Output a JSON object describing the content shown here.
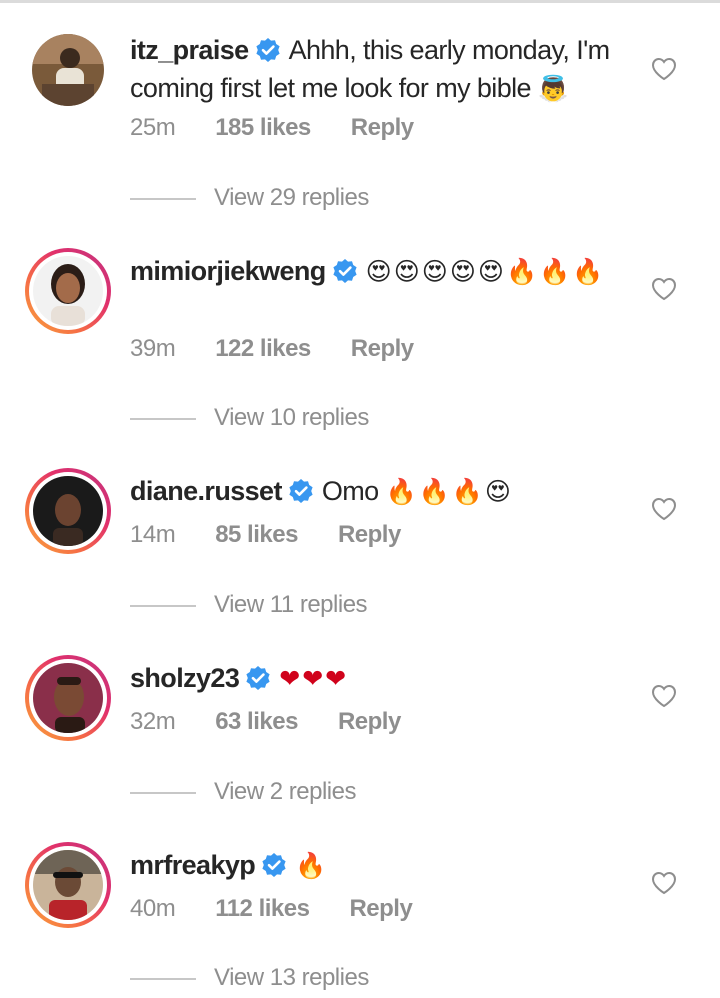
{
  "comments": [
    {
      "username": "itz_praise",
      "text": "Ahhh, this early monday, I'm coming first let me look for my bible",
      "emoji": "👼",
      "time": "25m",
      "likes": "185 likes",
      "reply": "Reply",
      "view_replies": "View 29 replies"
    },
    {
      "username": "mimiorjiekweng",
      "text": "",
      "emoji": "😍😍😍😍😍🔥🔥🔥",
      "time": "39m",
      "likes": "122 likes",
      "reply": "Reply",
      "view_replies": "View 10 replies"
    },
    {
      "username": "diane.russet",
      "text": "Omo",
      "emoji": "🔥🔥🔥😍",
      "time": "14m",
      "likes": "85 likes",
      "reply": "Reply",
      "view_replies": "View 11 replies"
    },
    {
      "username": "sholzy23",
      "text": "",
      "emoji": "❤❤❤",
      "time": "32m",
      "likes": "63 likes",
      "reply": "Reply",
      "view_replies": "View 2 replies"
    },
    {
      "username": "mrfreakyp",
      "text": "",
      "emoji": "🔥",
      "time": "40m",
      "likes": "112 likes",
      "reply": "Reply",
      "view_replies": "View 13 replies"
    }
  ],
  "colors": {
    "verified": "#3897f0",
    "muted": "#8e8e8e",
    "text": "#262626"
  },
  "icons": {
    "verified": "verified-badge-icon",
    "like": "heart-outline-icon"
  }
}
